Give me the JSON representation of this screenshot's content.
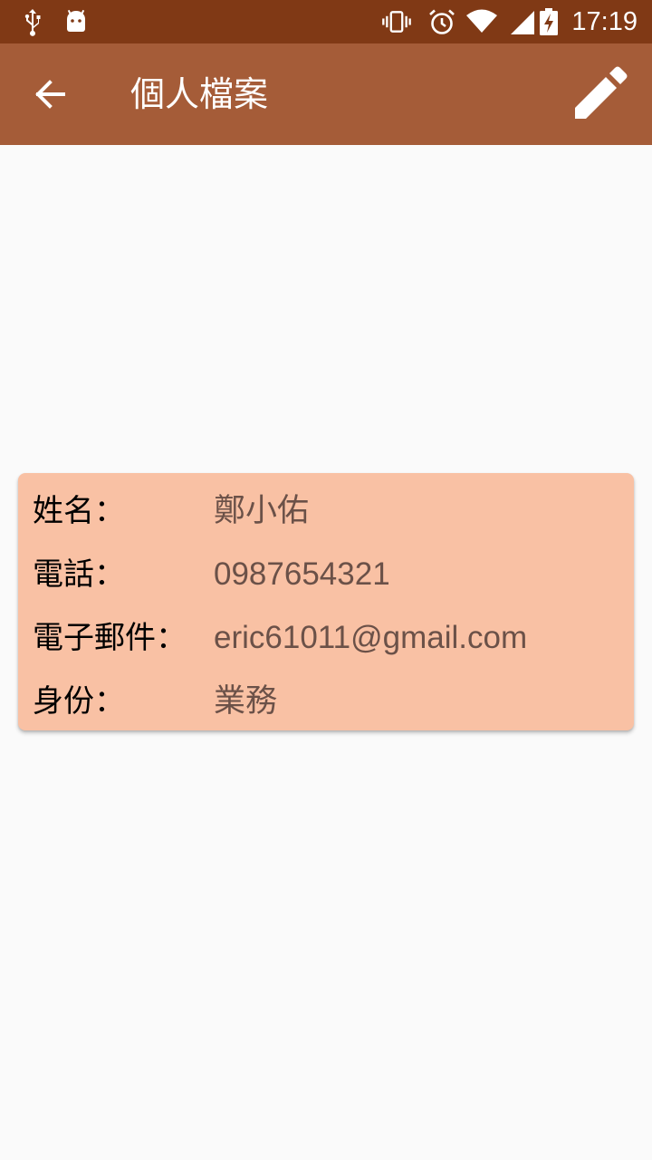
{
  "status_bar": {
    "time": "17:19",
    "left_icons": [
      "usb-icon",
      "android-debug-icon"
    ],
    "right_icons": [
      "vibrate-icon",
      "alarm-icon",
      "wifi-icon",
      "signal-icon",
      "battery-charging-icon"
    ],
    "background_color": "#803915"
  },
  "app_bar": {
    "title": "個人檔案",
    "back_icon": "arrow-back-icon",
    "edit_icon": "pencil-icon",
    "background_color": "#a55c38"
  },
  "profile": {
    "card_color": "#f9c1a4",
    "fields": [
      {
        "label": "姓名：",
        "value": "鄭小佑"
      },
      {
        "label": "電話：",
        "value": "0987654321"
      },
      {
        "label": "電子郵件：",
        "value": "eric61011@gmail.com"
      },
      {
        "label": "身份：",
        "value": "業務"
      }
    ]
  }
}
